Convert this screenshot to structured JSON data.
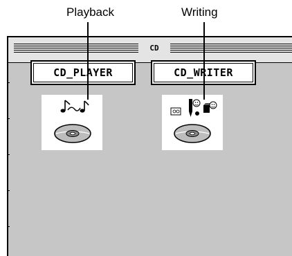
{
  "callouts": {
    "playback": "Playback",
    "writing": "Writing"
  },
  "window": {
    "title": "CD"
  },
  "buttons": {
    "player": "CD_PLAYER",
    "writer": "CD_WRITER"
  },
  "icons": {
    "player": "cd-player-icon",
    "writer": "cd-writer-icon"
  }
}
